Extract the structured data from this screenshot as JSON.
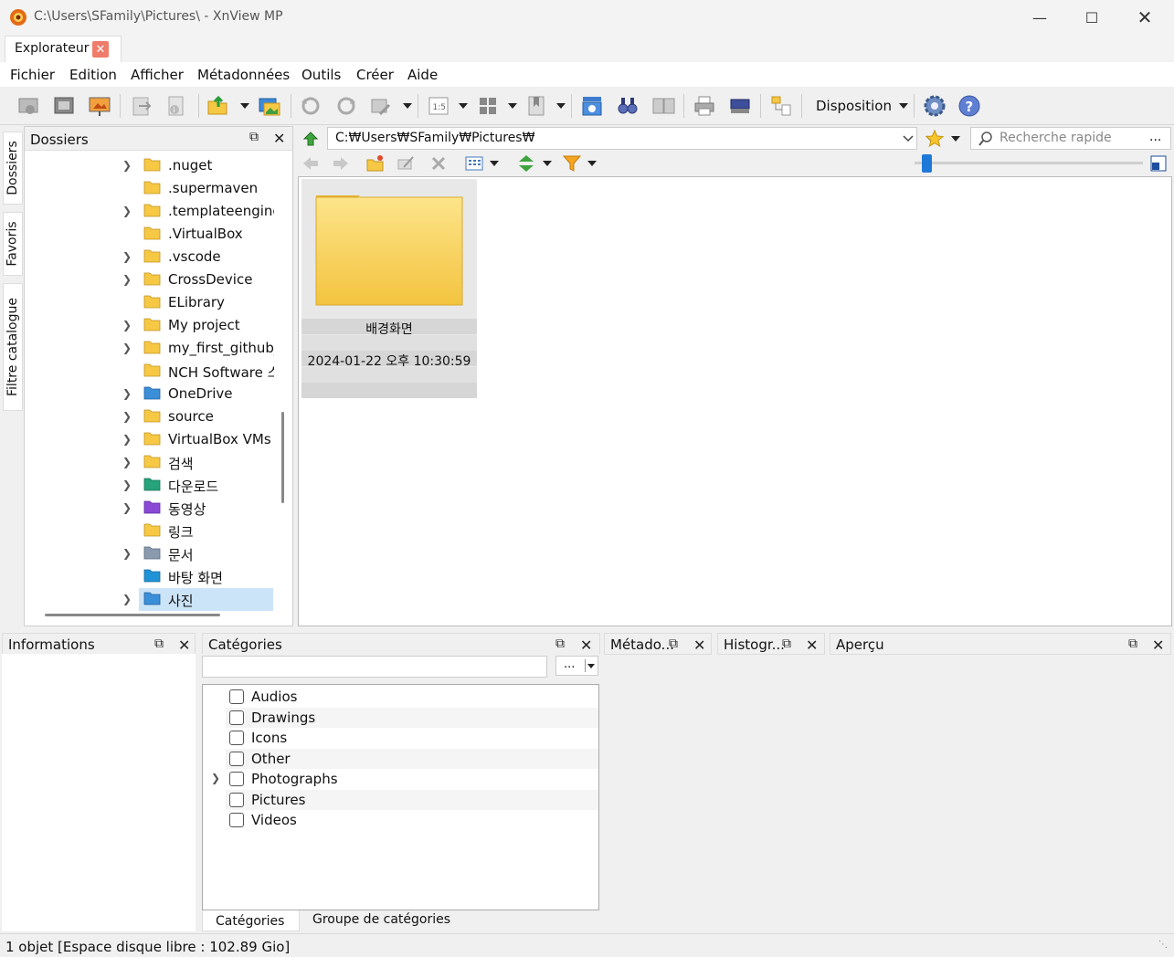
{
  "window": {
    "title": "C:\\Users\\SFamily\\Pictures\\ - XnView MP"
  },
  "tabs": [
    {
      "label": "Explorateur"
    }
  ],
  "menu": [
    "Fichier",
    "Edition",
    "Afficher",
    "Métadonnées",
    "Outils",
    "Créer",
    "Aide"
  ],
  "toolbar": {
    "layout_label": "Disposition",
    "zoom_label": "1:5"
  },
  "side_tabs": [
    "Dossiers",
    "Favoris",
    "Filtre catalogue"
  ],
  "folders": {
    "title": "Dossiers",
    "items": [
      {
        "label": ".nuget",
        "expandable": true,
        "icon": "folder-icon"
      },
      {
        "label": ".supermaven",
        "expandable": false,
        "icon": "folder-icon"
      },
      {
        "label": ".templateengine",
        "expandable": true,
        "icon": "folder-icon"
      },
      {
        "label": ".VirtualBox",
        "expandable": false,
        "icon": "folder-icon"
      },
      {
        "label": ".vscode",
        "expandable": true,
        "icon": "folder-icon"
      },
      {
        "label": "CrossDevice",
        "expandable": true,
        "icon": "folder-icon"
      },
      {
        "label": "ELibrary",
        "expandable": false,
        "icon": "folder-icon"
      },
      {
        "label": "My project",
        "expandable": true,
        "icon": "folder-icon"
      },
      {
        "label": "my_first_github_p",
        "expandable": true,
        "icon": "folder-icon"
      },
      {
        "label": "NCH Software 스",
        "expandable": false,
        "icon": "folder-icon"
      },
      {
        "label": "OneDrive",
        "expandable": true,
        "icon": "onedrive-folder-icon"
      },
      {
        "label": "source",
        "expandable": true,
        "icon": "folder-icon"
      },
      {
        "label": "VirtualBox VMs",
        "expandable": true,
        "icon": "folder-icon"
      },
      {
        "label": "검색",
        "expandable": true,
        "icon": "folder-icon"
      },
      {
        "label": "다운로드",
        "expandable": true,
        "icon": "downloads-folder-icon"
      },
      {
        "label": "동영상",
        "expandable": true,
        "icon": "videos-folder-icon"
      },
      {
        "label": "링크",
        "expandable": false,
        "icon": "folder-icon"
      },
      {
        "label": "문서",
        "expandable": true,
        "icon": "documents-folder-icon"
      },
      {
        "label": "바탕 화면",
        "expandable": false,
        "icon": "desktop-folder-icon"
      },
      {
        "label": "사진",
        "expandable": true,
        "icon": "pictures-folder-icon",
        "selected": true
      }
    ]
  },
  "address": {
    "path": "C:₩Users₩SFamily₩Pictures₩"
  },
  "search": {
    "placeholder": "Recherche rapide",
    "more": "..."
  },
  "browser": {
    "items": [
      {
        "name": "배경화면",
        "date": "2024-01-22 오후 10:30:59"
      }
    ]
  },
  "panels": {
    "info": "Informations",
    "categories": "Catégories",
    "metadata": "Métado...",
    "histogram": "Histogr...",
    "preview": "Aperçu"
  },
  "categories": {
    "filter_more": "...",
    "items": [
      {
        "label": "Audios",
        "expandable": false
      },
      {
        "label": "Drawings",
        "expandable": false
      },
      {
        "label": "Icons",
        "expandable": false
      },
      {
        "label": "Other",
        "expandable": false
      },
      {
        "label": "Photographs",
        "expandable": true
      },
      {
        "label": "Pictures",
        "expandable": false
      },
      {
        "label": "Videos",
        "expandable": false
      }
    ],
    "tabs": [
      "Catégories",
      "Groupe de catégories"
    ]
  },
  "status": {
    "text": "1 objet [Espace disque libre : 102.89 Gio]"
  },
  "colors": {
    "folder": "#f6c844",
    "accent": "#1e78d7",
    "selection": "#cce4f7"
  }
}
